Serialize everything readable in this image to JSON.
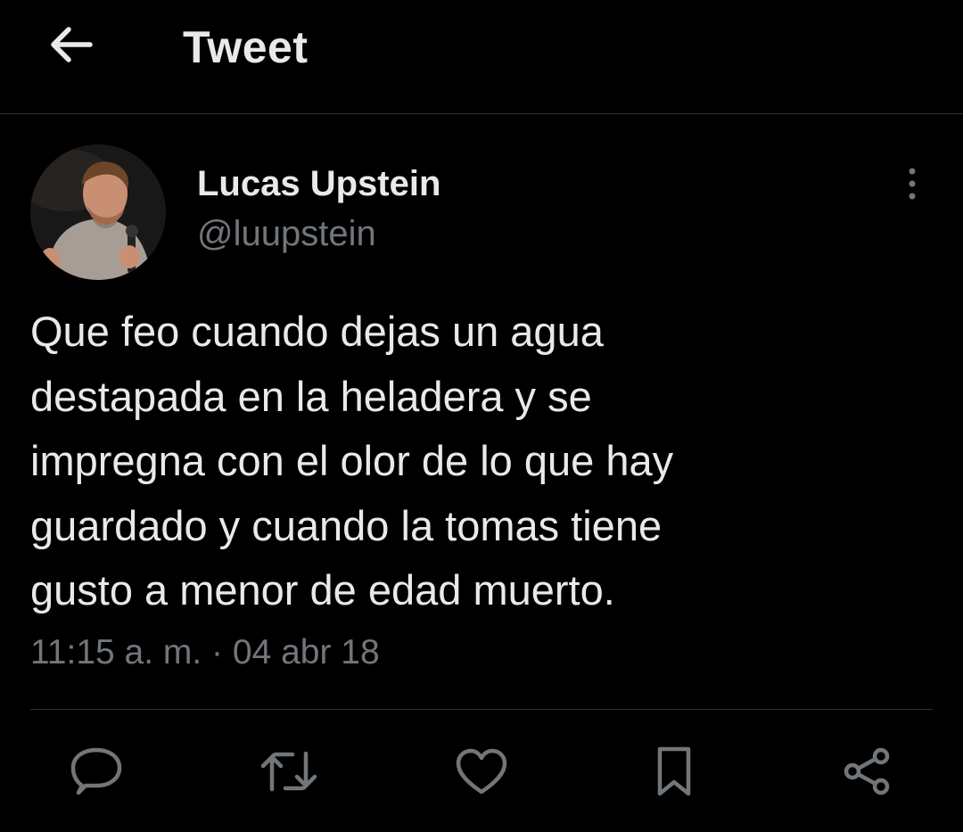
{
  "header": {
    "title": "Tweet",
    "back_icon": "arrow-left-icon"
  },
  "author": {
    "name": "Lucas Upstein",
    "handle": "@luupstein",
    "avatar_icon": "user-avatar"
  },
  "tweet": {
    "text": "Que feo cuando dejas un agua\ndestapada en la heladera y se\nimpregna con el olor de lo que hay\nguardado y cuando la tomas tiene\ngusto a menor de edad muerto.",
    "timestamp": "11:15 a. m. · 04 abr 18"
  },
  "actions": [
    {
      "name": "reply",
      "icon": "reply-icon"
    },
    {
      "name": "retweet",
      "icon": "retweet-icon"
    },
    {
      "name": "like",
      "icon": "heart-icon"
    },
    {
      "name": "bookmark",
      "icon": "bookmark-icon"
    },
    {
      "name": "share",
      "icon": "share-icon"
    }
  ],
  "colors": {
    "background": "#000000",
    "primary_text": "#e7e9ea",
    "secondary_text": "#71767b",
    "divider": "#2f3336"
  }
}
